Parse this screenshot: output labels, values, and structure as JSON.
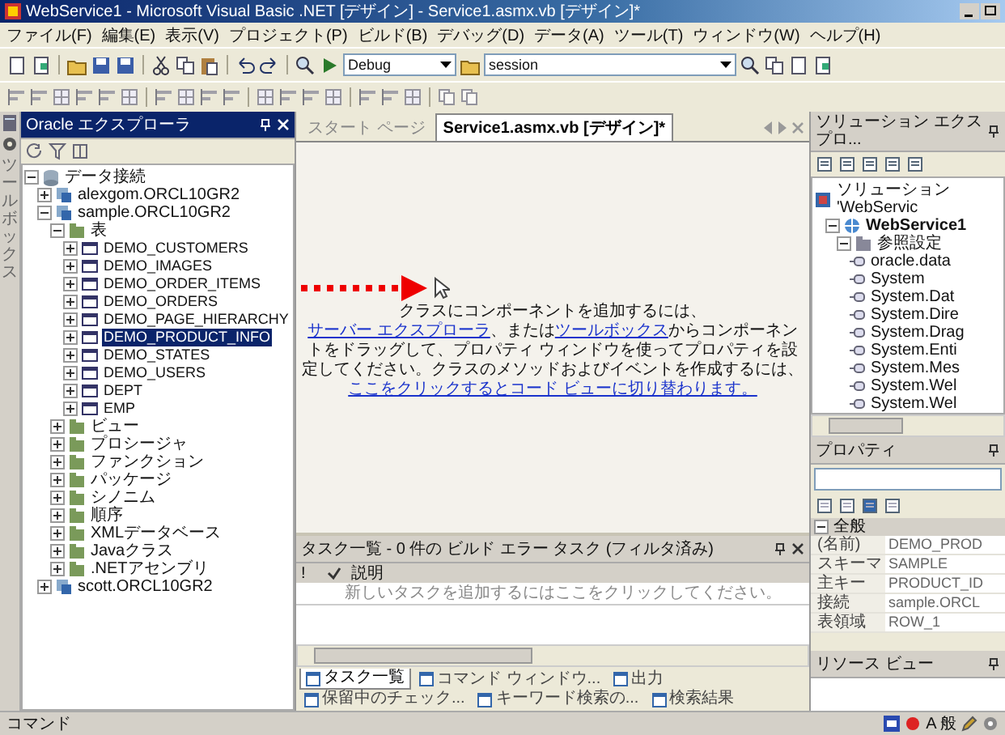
{
  "window": {
    "title": "WebService1 - Microsoft Visual Basic .NET [デザイン] - Service1.asmx.vb [デザイン]*"
  },
  "menu": [
    "ファイル(F)",
    "編集(E)",
    "表示(V)",
    "プロジェクト(P)",
    "ビルド(B)",
    "デバッグ(D)",
    "データ(A)",
    "ツール(T)",
    "ウィンドウ(W)",
    "ヘルプ(H)"
  ],
  "toolbar": {
    "configuration": "Debug",
    "search": "session"
  },
  "side_strip": {
    "label": "ツールボックス"
  },
  "left_panel": {
    "title": "Oracle エクスプローラ",
    "tree": [
      {
        "label": "データ接続",
        "kind": "root",
        "expanded": true,
        "selected": false,
        "children": [
          {
            "label": "alexgom.ORCL10GR2",
            "kind": "connection",
            "expanded": false,
            "selected": false
          },
          {
            "label": "sample.ORCL10GR2",
            "kind": "connection",
            "expanded": true,
            "selected": false,
            "children": [
              {
                "label": "表",
                "kind": "folder",
                "expanded": true,
                "selected": false,
                "children": [
                  {
                    "label": "DEMO_CUSTOMERS",
                    "kind": "table",
                    "expanded": false,
                    "selected": false
                  },
                  {
                    "label": "DEMO_IMAGES",
                    "kind": "table",
                    "expanded": false,
                    "selected": false
                  },
                  {
                    "label": "DEMO_ORDER_ITEMS",
                    "kind": "table",
                    "expanded": false,
                    "selected": false
                  },
                  {
                    "label": "DEMO_ORDERS",
                    "kind": "table",
                    "expanded": false,
                    "selected": false
                  },
                  {
                    "label": "DEMO_PAGE_HIERARCHY",
                    "kind": "table",
                    "expanded": false,
                    "selected": false
                  },
                  {
                    "label": "DEMO_PRODUCT_INFO",
                    "kind": "table",
                    "expanded": false,
                    "selected": true
                  },
                  {
                    "label": "DEMO_STATES",
                    "kind": "table",
                    "expanded": false,
                    "selected": false
                  },
                  {
                    "label": "DEMO_USERS",
                    "kind": "table",
                    "expanded": false,
                    "selected": false
                  },
                  {
                    "label": "DEPT",
                    "kind": "table",
                    "expanded": false,
                    "selected": false
                  },
                  {
                    "label": "EMP",
                    "kind": "table",
                    "expanded": false,
                    "selected": false
                  }
                ]
              },
              {
                "label": "ビュー",
                "kind": "folder",
                "expanded": false,
                "selected": false
              },
              {
                "label": "プロシージャ",
                "kind": "folder",
                "expanded": false,
                "selected": false
              },
              {
                "label": "ファンクション",
                "kind": "folder",
                "expanded": false,
                "selected": false
              },
              {
                "label": "パッケージ",
                "kind": "folder",
                "expanded": false,
                "selected": false
              },
              {
                "label": "シノニム",
                "kind": "folder",
                "expanded": false,
                "selected": false
              },
              {
                "label": "順序",
                "kind": "folder",
                "expanded": false,
                "selected": false
              },
              {
                "label": "XMLデータベース",
                "kind": "folder",
                "expanded": false,
                "selected": false
              },
              {
                "label": "Javaクラス",
                "kind": "folder",
                "expanded": false,
                "selected": false
              },
              {
                "label": ".NETアセンブリ",
                "kind": "folder",
                "expanded": false,
                "selected": false
              }
            ]
          },
          {
            "label": "scott.ORCL10GR2",
            "kind": "connection",
            "expanded": false,
            "selected": false
          }
        ]
      }
    ]
  },
  "editor": {
    "tabs": [
      {
        "label": "スタート ページ",
        "selected": false
      },
      {
        "label": "Service1.asmx.vb [デザイン]*",
        "selected": true
      }
    ],
    "message": [
      {
        "kind": "text",
        "text": "クラスにコンポーネントを追加するには、"
      },
      {
        "kind": "link",
        "text": "サーバー エクスプローラ"
      },
      {
        "kind": "text",
        "text": "、または"
      },
      {
        "kind": "link",
        "text": "ツールボックス"
      },
      {
        "kind": "text",
        "text": "からコンポーネントをドラッグして、プロパティ ウィンドウを使ってプロパティを設定してください。クラスのメソッドおよびイベントを作成するには、"
      },
      {
        "kind": "link",
        "text": "ここをクリックするとコード ビューに切り替わります。"
      }
    ]
  },
  "task_list": {
    "title": "タスク一覧 - 0 件の ビルド エラー タスク (フィルタ済み)",
    "columns": [
      "!",
      "説明"
    ],
    "new_row": "新しいタスクを追加するにはここをクリックしてください。"
  },
  "bottom_tabs": [
    {
      "label": "タスク一覧",
      "selected": true
    },
    {
      "label": "コマンド ウィンドウ...",
      "selected": false
    },
    {
      "label": "出力",
      "selected": false
    },
    {
      "label": "保留中のチェック...",
      "selected": false
    },
    {
      "label": "キーワード検索の...",
      "selected": false
    },
    {
      "label": "検索結果",
      "selected": false
    }
  ],
  "solution_explorer": {
    "title": "ソリューション エクスプロ...",
    "tree": [
      {
        "label": "ソリューション 'WebServic",
        "kind": "solution",
        "selected": false,
        "children": [
          {
            "label": "WebService1",
            "kind": "project",
            "expanded": true,
            "selected": false,
            "children": [
              {
                "label": "参照設定",
                "kind": "folder",
                "expanded": true,
                "selected": false,
                "children": [
                  {
                    "label": "oracle.data",
                    "kind": "reference",
                    "selected": false
                  },
                  {
                    "label": "System",
                    "kind": "reference",
                    "selected": false
                  },
                  {
                    "label": "System.Dat",
                    "kind": "reference",
                    "selected": false
                  },
                  {
                    "label": "System.Dire",
                    "kind": "reference",
                    "selected": false
                  },
                  {
                    "label": "System.Drag",
                    "kind": "reference",
                    "selected": false
                  },
                  {
                    "label": "System.Enti",
                    "kind": "reference",
                    "selected": false
                  },
                  {
                    "label": "System.Mes",
                    "kind": "reference",
                    "selected": false
                  },
                  {
                    "label": "System.Wel",
                    "kind": "reference",
                    "selected": false
                  },
                  {
                    "label": "System.Wel",
                    "kind": "reference",
                    "selected": false
                  }
                ]
              }
            ]
          }
        ]
      }
    ]
  },
  "properties": {
    "title": "プロパティ",
    "category": "全般",
    "rows": [
      {
        "name": "(名前)",
        "value": "DEMO_PROD"
      },
      {
        "name": "スキーマ",
        "value": "SAMPLE"
      },
      {
        "name": "主キー",
        "value": "PRODUCT_ID"
      },
      {
        "name": "接続",
        "value": "sample.ORCL"
      },
      {
        "name": "表領域",
        "value": "ROW_1"
      }
    ]
  },
  "resource_view": {
    "title": "リソース ビュー"
  },
  "status_bar": {
    "text": "コマンド",
    "ime": "A 般"
  }
}
